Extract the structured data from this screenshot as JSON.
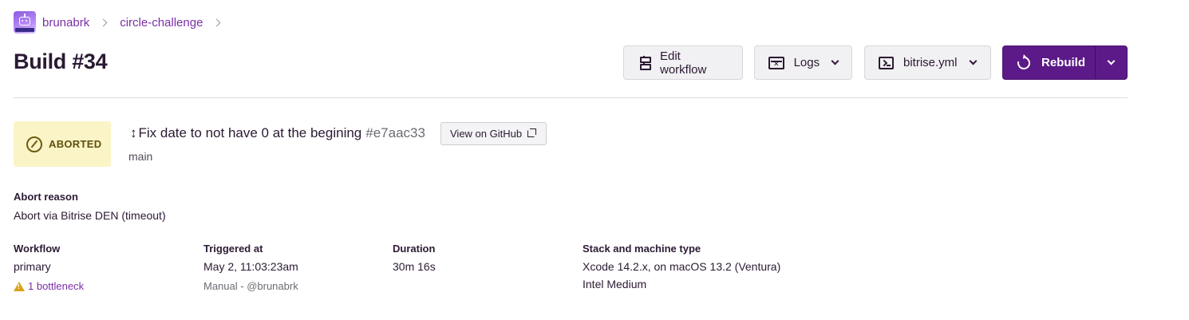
{
  "breadcrumb": {
    "items": [
      {
        "label": "brunabrk"
      },
      {
        "label": "circle-challenge"
      }
    ]
  },
  "page": {
    "title": "Build #34"
  },
  "toolbar": {
    "edit_workflow_label": "Edit workflow",
    "logs_label": "Logs",
    "config_label": "bitrise.yml",
    "rebuild_label": "Rebuild",
    "rebuild_color": "#5c1a88"
  },
  "status": {
    "label": "ABORTED",
    "background": "#fbf4c7",
    "icon": "aborted-icon"
  },
  "commit": {
    "message": "Fix date to not have 0 at the begining",
    "hash": "#e7aac33",
    "github_button_label": "View on GitHub",
    "branch": "main"
  },
  "abort": {
    "label": "Abort reason",
    "value": "Abort via Bitrise DEN (timeout)"
  },
  "details": {
    "workflow": {
      "label": "Workflow",
      "value": "primary",
      "bottleneck": "1 bottleneck"
    },
    "triggered": {
      "label": "Triggered at",
      "value": "May 2, 11:03:23am",
      "sub": "Manual - @brunabrk"
    },
    "duration": {
      "label": "Duration",
      "value": "30m 16s"
    },
    "stack": {
      "label": "Stack and machine type",
      "value": "Xcode 14.2.x, on macOS 13.2 (Ventura)",
      "machine": "Intel Medium"
    }
  }
}
